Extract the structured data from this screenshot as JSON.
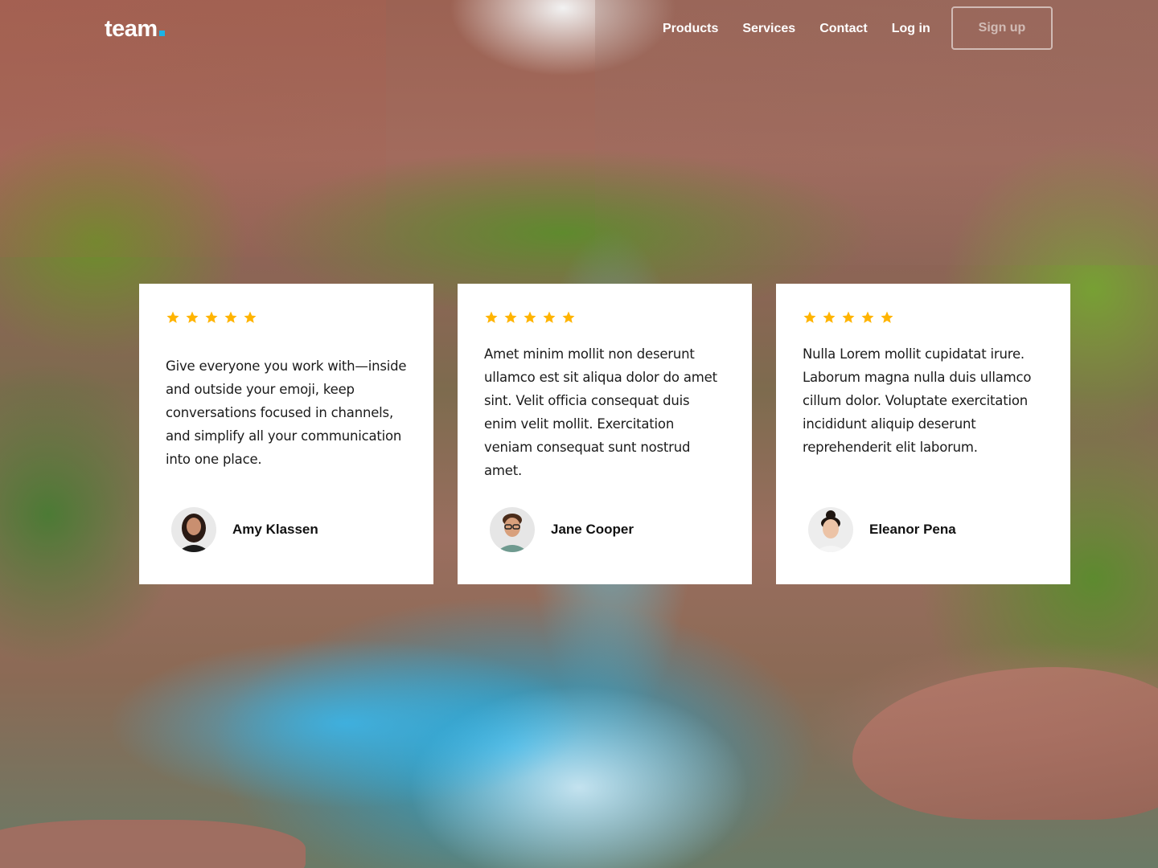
{
  "header": {
    "logo_text": "team",
    "nav": [
      "Products",
      "Services",
      "Contact",
      "Log in"
    ],
    "signup_label": "Sign up"
  },
  "testimonials": [
    {
      "rating": 5,
      "quote": "Give everyone you work with—inside and outside your emoji, keep conversations focused in channels, and simplify all your communication into one place.",
      "name": "Amy Klassen"
    },
    {
      "rating": 5,
      "quote": "Amet minim mollit non deserunt ullamco est sit aliqua dolor do amet sint. Velit officia consequat duis enim velit mollit. Exercitation veniam consequat sunt nostrud amet.",
      "name": "Jane Cooper"
    },
    {
      "rating": 5,
      "quote": "Nulla Lorem mollit cupidatat irure. Laborum magna nulla duis ullamco cillum dolor. Voluptate exercitation incididunt aliquip deserunt reprehenderit elit laborum.",
      "name": "Eleanor Pena"
    }
  ],
  "colors": {
    "star": "#FFB400",
    "logo_dot": "#1BB3E6",
    "card_bg": "#FFFFFF"
  }
}
